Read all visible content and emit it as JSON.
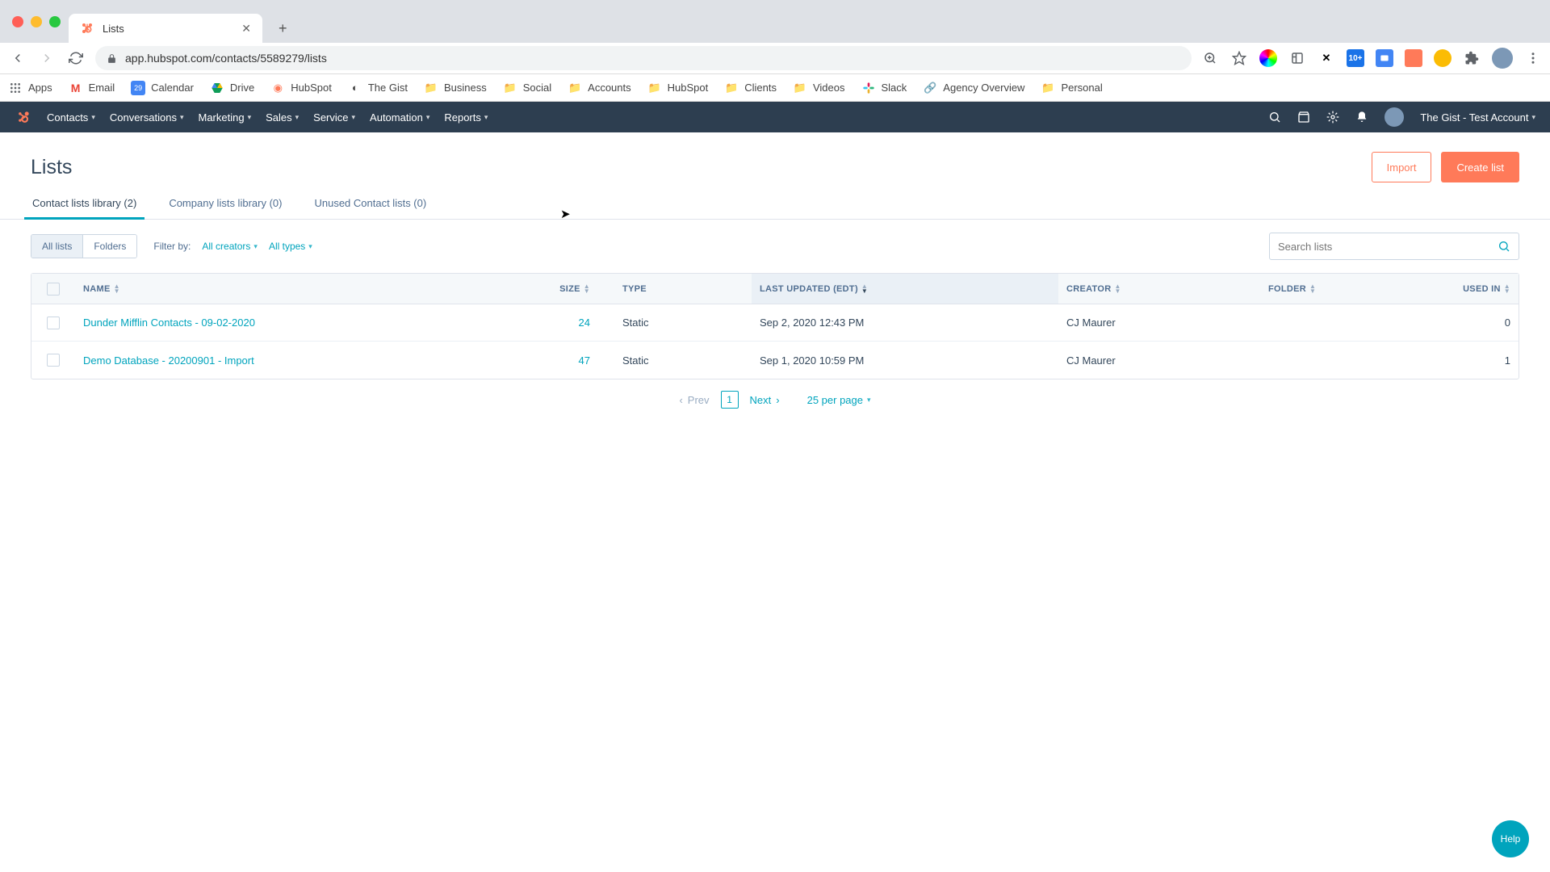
{
  "browser": {
    "tab_title": "Lists",
    "url": "app.hubspot.com/contacts/5589279/lists",
    "bookmarks": [
      "Apps",
      "Email",
      "Calendar",
      "Drive",
      "HubSpot",
      "The Gist",
      "Business",
      "Social",
      "Accounts",
      "HubSpot",
      "Clients",
      "Videos",
      "Slack",
      "Agency Overview",
      "Personal"
    ]
  },
  "hs_nav": {
    "items": [
      "Contacts",
      "Conversations",
      "Marketing",
      "Sales",
      "Service",
      "Automation",
      "Reports"
    ],
    "account": "The Gist - Test Account"
  },
  "header": {
    "title": "Lists",
    "import_btn": "Import",
    "create_btn": "Create list"
  },
  "tabs": [
    "Contact lists library (2)",
    "Company lists library (0)",
    "Unused Contact lists (0)"
  ],
  "filters": {
    "all_lists": "All lists",
    "folders": "Folders",
    "filter_by": "Filter by:",
    "creators": "All creators",
    "types": "All types"
  },
  "search": {
    "placeholder": "Search lists"
  },
  "table": {
    "headers": {
      "name": "NAME",
      "size": "SIZE",
      "type": "TYPE",
      "last_updated": "LAST UPDATED (EDT)",
      "creator": "CREATOR",
      "folder": "FOLDER",
      "used_in": "USED IN"
    },
    "rows": [
      {
        "name": "Dunder Mifflin Contacts - 09-02-2020",
        "size": "24",
        "type": "Static",
        "last_updated": "Sep 2, 2020 12:43 PM",
        "creator": "CJ Maurer",
        "folder": "",
        "used_in": "0"
      },
      {
        "name": "Demo Database - 20200901 - Import",
        "size": "47",
        "type": "Static",
        "last_updated": "Sep 1, 2020 10:59 PM",
        "creator": "CJ Maurer",
        "folder": "",
        "used_in": "1"
      }
    ]
  },
  "pagination": {
    "prev": "Prev",
    "page": "1",
    "next": "Next",
    "per_page": "25 per page"
  },
  "help": "Help"
}
